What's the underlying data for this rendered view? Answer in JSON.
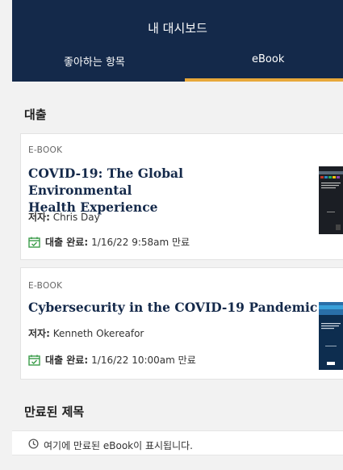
{
  "header": {
    "title": "내 대시보드",
    "tabs": [
      {
        "label": "좋아하는 항목",
        "active": false
      },
      {
        "label": "eBook",
        "active": true
      }
    ],
    "bg_color": "#14294a",
    "accent_color": "#e8a83a"
  },
  "loans": {
    "section_title": "대출",
    "items": [
      {
        "type": "E-BOOK",
        "title_line1": "COVID-19: The Global Environmental",
        "title_line2": "Health Experience",
        "author_label": "저자:",
        "author": "Chris Day",
        "status_label": "대출 완료:",
        "status_value": "1/16/22 9:58am 만료",
        "icon": "calendar-check-icon"
      },
      {
        "type": "E-BOOK",
        "title_line1": "Cybersecurity in the COVID-19 Pandemic",
        "author_label": "저자:",
        "author": "Kenneth Okereafor",
        "status_label": "대출 완료:",
        "status_value": "1/16/22 10:00am 만료",
        "icon": "calendar-check-icon"
      }
    ]
  },
  "expired": {
    "section_title": "만료된 제목",
    "message": "여기에 만료된 eBook이 표시됩니다.",
    "icon": "clock-icon"
  }
}
